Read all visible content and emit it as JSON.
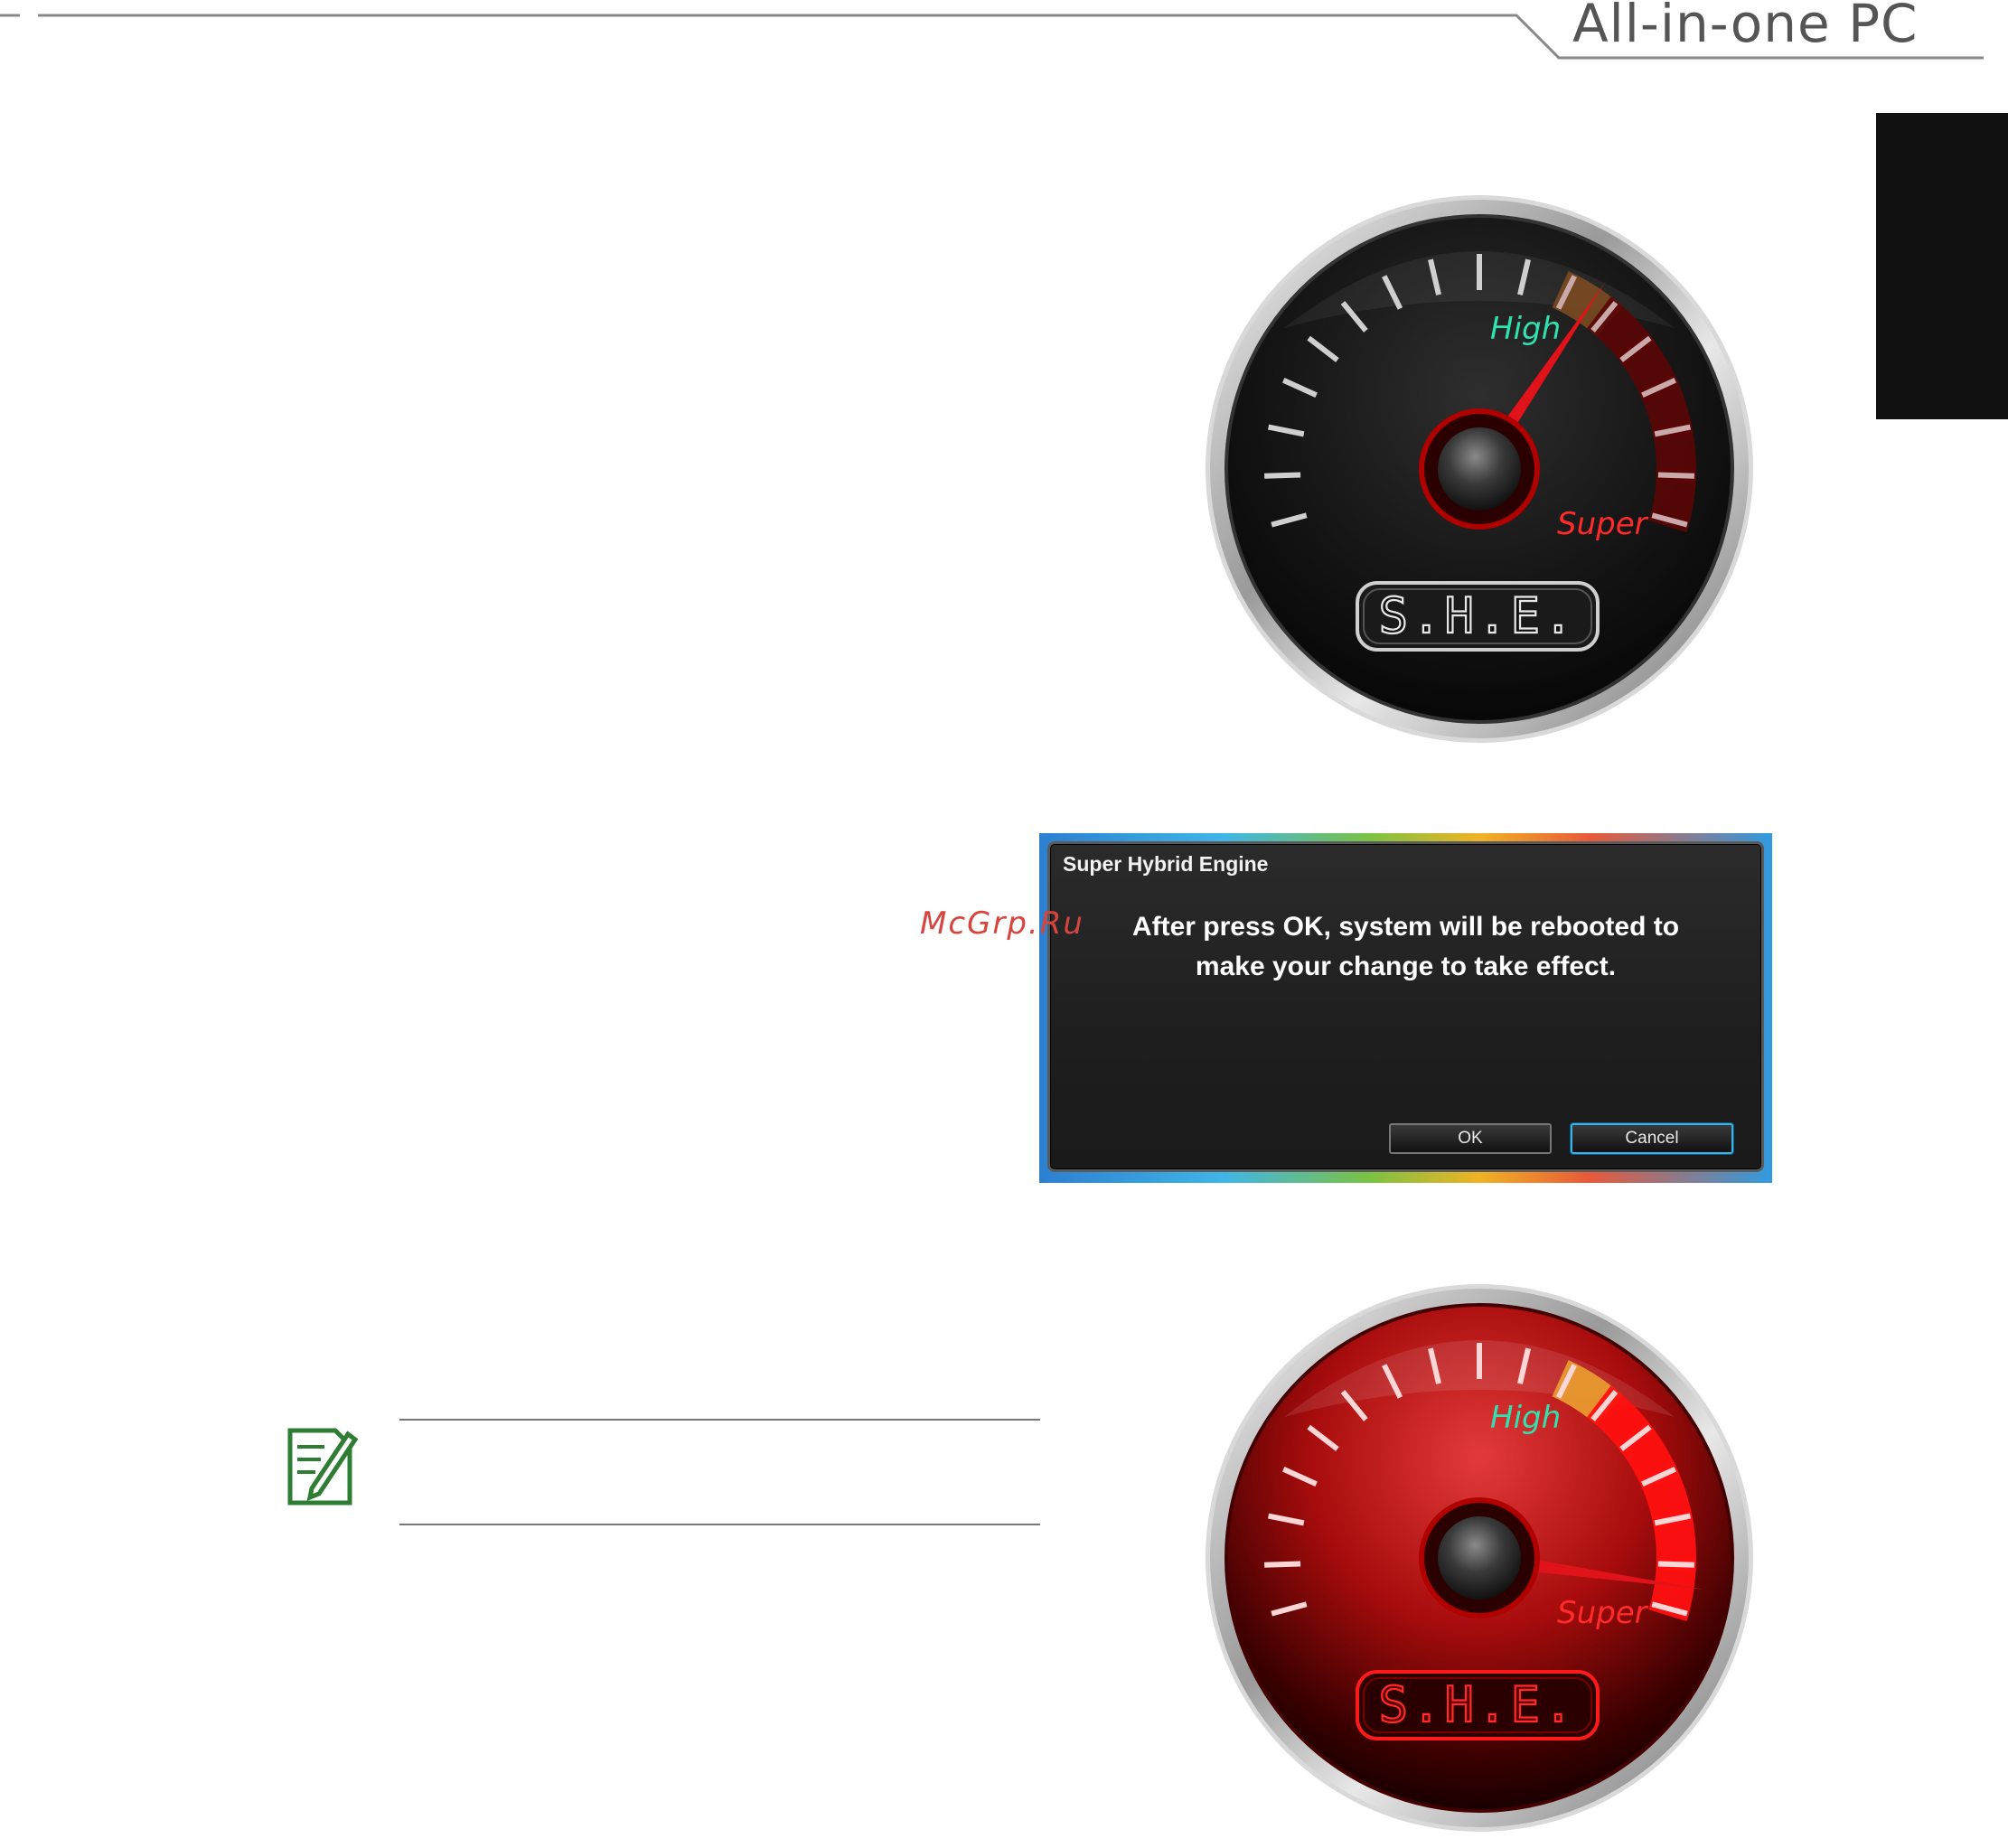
{
  "header": {
    "title": "All-in-one PC"
  },
  "gauge_high": {
    "high_label": "High",
    "super_label": "Super",
    "badge": "S.H.E.",
    "theme": "black",
    "needle_setting": "High"
  },
  "dialog": {
    "title": "Super Hybrid Engine",
    "message": "After press OK, system will be rebooted to make your change to take effect.",
    "ok_label": "OK",
    "cancel_label": "Cancel"
  },
  "watermark": {
    "text": "McGrp.Ru"
  },
  "gauge_super": {
    "high_label": "High",
    "super_label": "Super",
    "badge": "S.H.E.",
    "theme": "red",
    "needle_setting": "Super"
  },
  "note": {
    "icon": "note-icon"
  },
  "colors": {
    "high_label": "#2fe3b0",
    "super_label": "#ff2a2a",
    "needle": "#e0121a",
    "tab": "#111111",
    "cancel_focus": "#3ab4e8"
  }
}
